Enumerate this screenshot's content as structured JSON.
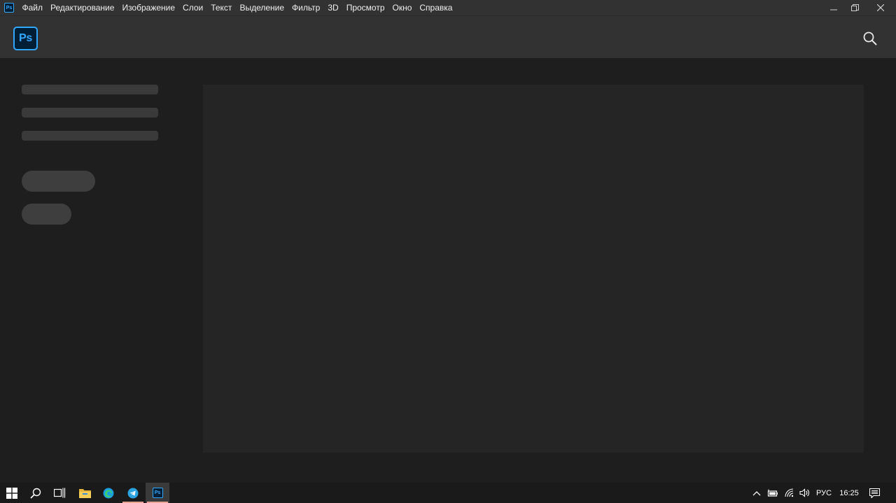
{
  "app": {
    "icon_label": "Ps",
    "brand_color": "#31a8ff",
    "brand_bg": "#001e36"
  },
  "menu": {
    "items": [
      "Файл",
      "Редактирование",
      "Изображение",
      "Слои",
      "Текст",
      "Выделение",
      "Фильтр",
      "3D",
      "Просмотр",
      "Окно",
      "Справка"
    ]
  },
  "window_controls": {
    "minimize_icon": "minimize-icon",
    "restore_icon": "restore-icon",
    "close_icon": "close-icon"
  },
  "header": {
    "logo_label": "Ps",
    "search_icon": "search-icon"
  },
  "taskbar": {
    "apps": [
      "windows-start-icon",
      "search-icon",
      "task-view-icon",
      "file-explorer-icon",
      "edge-icon",
      "telegram-icon",
      "photoshop-icon"
    ],
    "photoshop_label": "Ps",
    "language": "РУС",
    "time": "16:25",
    "underline_color": "#e8a594"
  }
}
